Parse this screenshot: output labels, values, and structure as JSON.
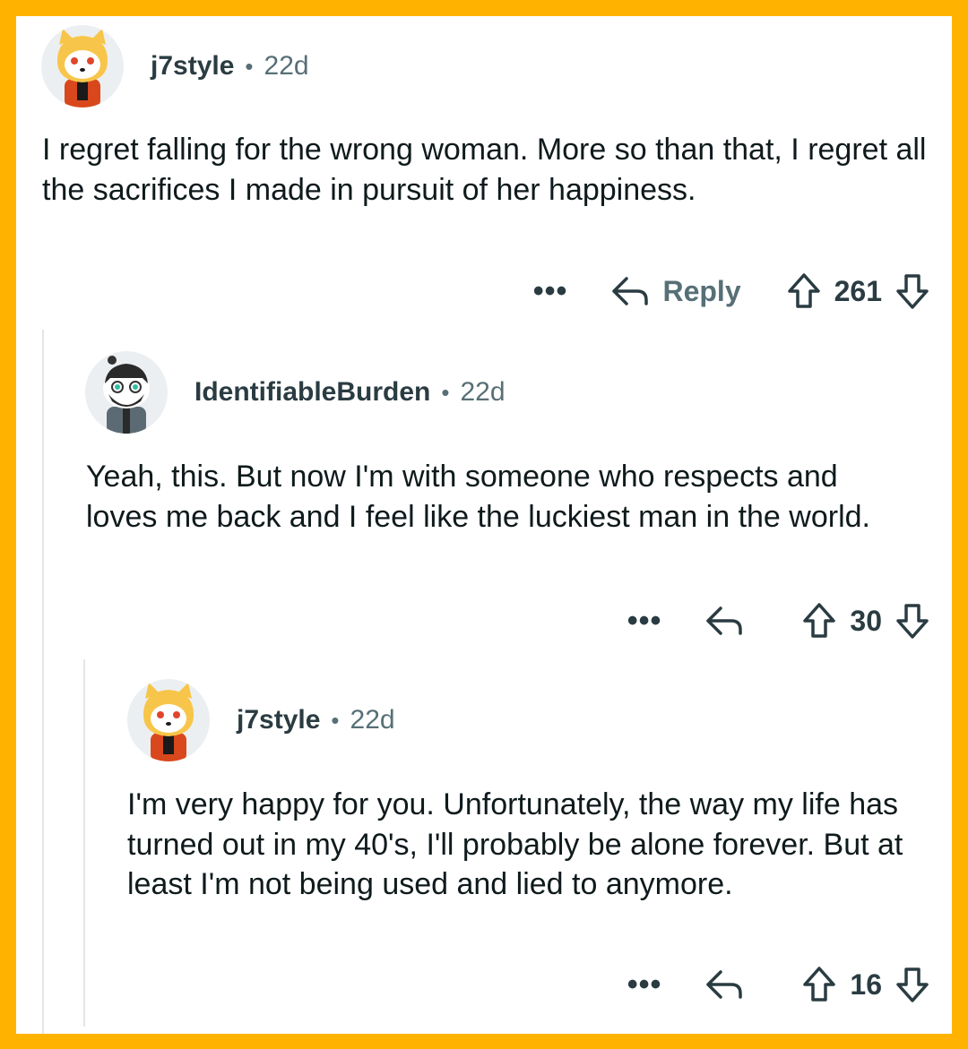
{
  "colors": {
    "frame": "#ffb300",
    "card": "#ffffff",
    "text": "#0f1a1c",
    "meta": "#576f76",
    "thread_line": "#e3e6e8"
  },
  "comments": [
    {
      "username": "j7style",
      "separator": "•",
      "age": "22d",
      "avatar_icon": "shiba-snoo-avatar-icon",
      "text": "I regret falling for the wrong woman. More so than that,  I regret all the sacrifices I made in pursuit of her happiness.",
      "more": "•••",
      "reply_label": "Reply",
      "votes": "261"
    },
    {
      "username": "IdentifiableBurden",
      "separator": "•",
      "age": "22d",
      "avatar_icon": "bearded-snoo-avatar-icon",
      "text": "Yeah, this. But now I'm with someone who respects and loves me back and I feel like the luckiest man in the world.",
      "more": "•••",
      "reply_label": "",
      "votes": "30"
    },
    {
      "username": "j7style",
      "separator": "•",
      "age": "22d",
      "avatar_icon": "shiba-snoo-avatar-icon",
      "text": "I'm very happy for you. Unfortunately, the way my life has turned out in my 40's, I'll probably be alone forever.  But at least I'm not being used and lied to anymore.",
      "more": "•••",
      "reply_label": "",
      "votes": "16"
    }
  ]
}
